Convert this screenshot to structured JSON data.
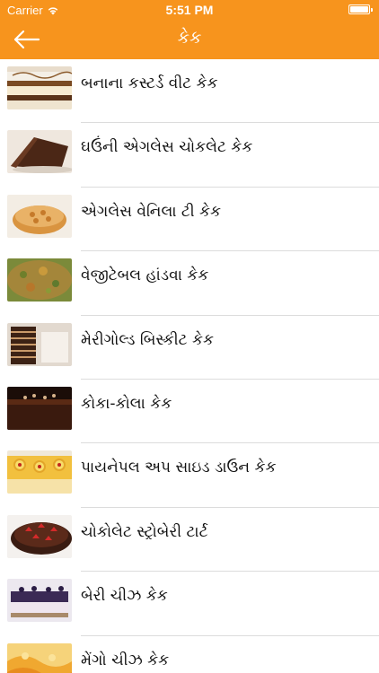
{
  "status_bar": {
    "carrier": "Carrier",
    "time": "5:51 PM",
    "battery_level": 1.0
  },
  "nav_bar": {
    "title": "કેક",
    "back_icon": "arrow-left-icon",
    "background_color": "#f7941d"
  },
  "recipes": [
    {
      "name": "બનાના કસ્ટર્ડ વીટ કેક"
    },
    {
      "name": "ઘઉંની એગલેસ ચોકલેટ કેક"
    },
    {
      "name": "એગલેસ વેનિલા ટી કેક"
    },
    {
      "name": "વેજીટેબલ હાંડવા કેક"
    },
    {
      "name": "મેરીગોલ્ડ બિસ્કીટ કેક"
    },
    {
      "name": "કોકા-કોલા કેક"
    },
    {
      "name": "પાયનેપલ અપ સાઇડ ડાઉન કેક"
    },
    {
      "name": "ચોકોલેટ સ્ટ્રોબેરી ટાર્ટ"
    },
    {
      "name": "બેરી ચીઝ કેક"
    },
    {
      "name": "મેંગો ચીઝ કેક"
    }
  ]
}
